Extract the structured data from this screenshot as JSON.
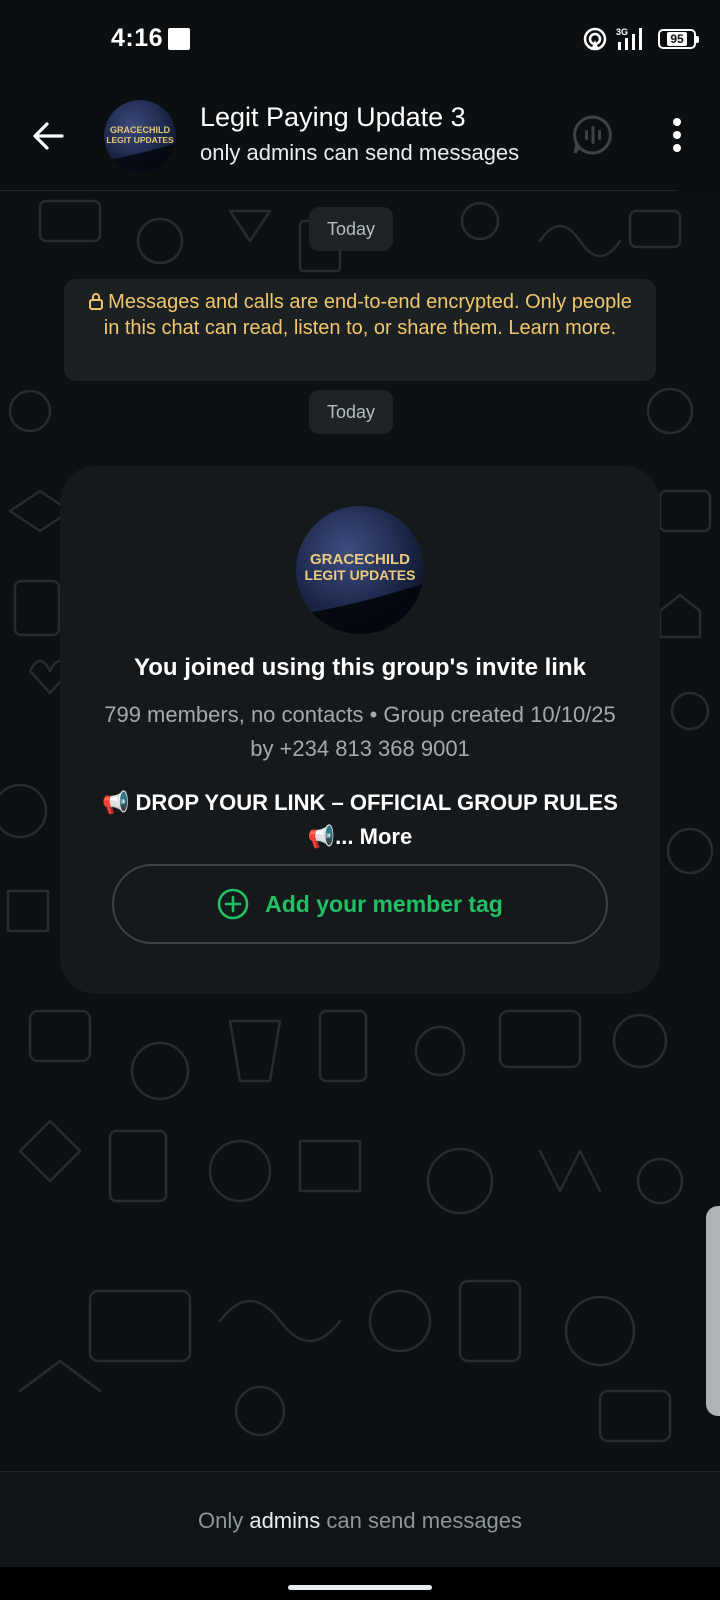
{
  "status_bar": {
    "time": "4:16",
    "network": "3G",
    "battery": "95"
  },
  "header": {
    "title": "Legit Paying Update 3",
    "subtitle": "only admins can send messages",
    "avatar_text_line1": "GRACECHILD",
    "avatar_text_line2": "LEGIT UPDATES"
  },
  "chat": {
    "date_chip_1": "Today",
    "encryption_notice": "Messages and calls are end-to-end encrypted. Only people in this chat can read, listen to, or share them. Learn more.",
    "date_chip_2": "Today"
  },
  "group_card": {
    "avatar_text_line1": "GRACECHILD",
    "avatar_text_line2": "LEGIT UPDATES",
    "joined_text": "You joined using this group's invite link",
    "meta_text": "799 members, no contacts • Group created 10/10/25 by +234 813 368 9001",
    "description_text": "📢 DROP YOUR LINK – OFFICIAL GROUP RULES 📢...",
    "more_label": "More",
    "add_tag_label": "Add your member tag"
  },
  "footer": {
    "text_before": "Only ",
    "admins_link": "admins",
    "text_after": " can send messages"
  },
  "colors": {
    "accent_green": "#21c063",
    "encryption_yellow": "#f2c66d",
    "background": "#0b0f11"
  },
  "icons": [
    "back-arrow-icon",
    "voice-chat-icon",
    "more-vert-icon",
    "lock-icon",
    "add-circle-icon",
    "hotspot-icon",
    "signal-icon",
    "battery-icon"
  ]
}
